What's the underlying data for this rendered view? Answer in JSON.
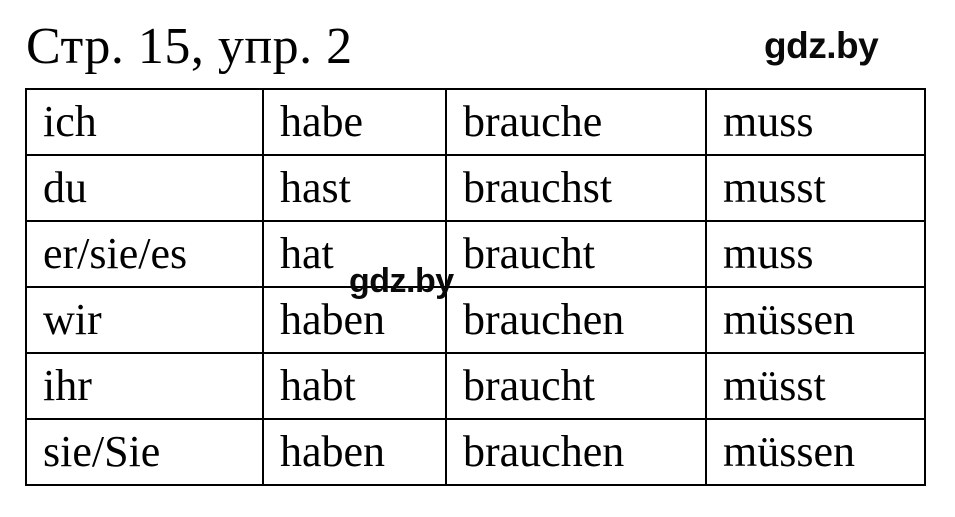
{
  "page": {
    "title": "Стр. 15, упр. 2",
    "background_color": "#ffffff",
    "text_color": "#000000"
  },
  "watermarks": {
    "top_right": "gdz.by",
    "overlay_middle": "gdz.by"
  },
  "table": {
    "name": "german-verb-conjugation-table",
    "columns": 4,
    "rows": [
      [
        "ich",
        "habe",
        "brauche",
        "muss"
      ],
      [
        "du",
        "hast",
        "brauchst",
        "musst"
      ],
      [
        "er/sie/es",
        "hat",
        "braucht",
        "muss"
      ],
      [
        "wir",
        "haben",
        "brauchen",
        "müssen"
      ],
      [
        "ihr",
        "habt",
        "braucht",
        "müsst"
      ],
      [
        "sie/Sie",
        "haben",
        "brauchen",
        "müssen"
      ]
    ]
  }
}
